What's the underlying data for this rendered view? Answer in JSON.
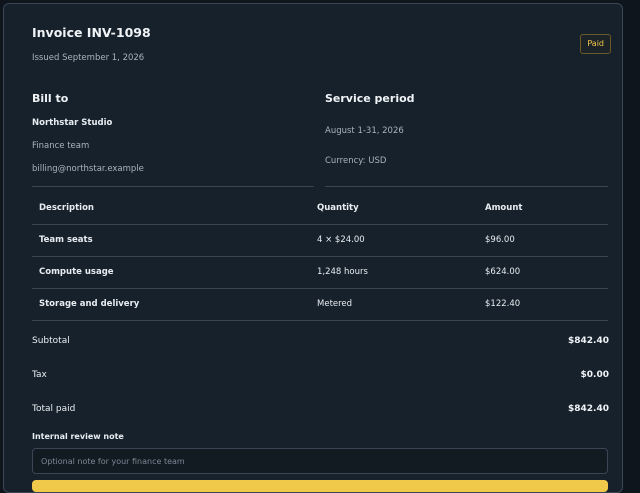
{
  "invoice": {
    "title": "Invoice INV-1098",
    "issued": "Issued September 1, 2026",
    "status": "Paid"
  },
  "bill_to": {
    "heading": "Bill to",
    "name": "Northstar Studio",
    "team": "Finance team",
    "email": "billing@northstar.example"
  },
  "service": {
    "heading": "Service period",
    "period": "August 1-31, 2026",
    "currency": "Currency: USD"
  },
  "table": {
    "headers": [
      "Description",
      "Quantity",
      "Amount"
    ],
    "rows": [
      [
        "Team seats",
        "4 × $24.00",
        "$96.00"
      ],
      [
        "Compute usage",
        "1,248 hours",
        "$624.00"
      ],
      [
        "Storage and delivery",
        "Metered",
        "$122.40"
      ]
    ]
  },
  "totals": {
    "subtotal_label": "Subtotal",
    "subtotal": "$842.40",
    "tax_label": "Tax",
    "tax": "$0.00",
    "total_label": "Total paid",
    "total": "$842.40"
  },
  "note": {
    "label": "Internal review note",
    "placeholder": "Optional note for your finance team",
    "value": ""
  },
  "colors": {
    "background": "#0e151d",
    "card": "#17212b",
    "accent": "#f0c84a"
  }
}
